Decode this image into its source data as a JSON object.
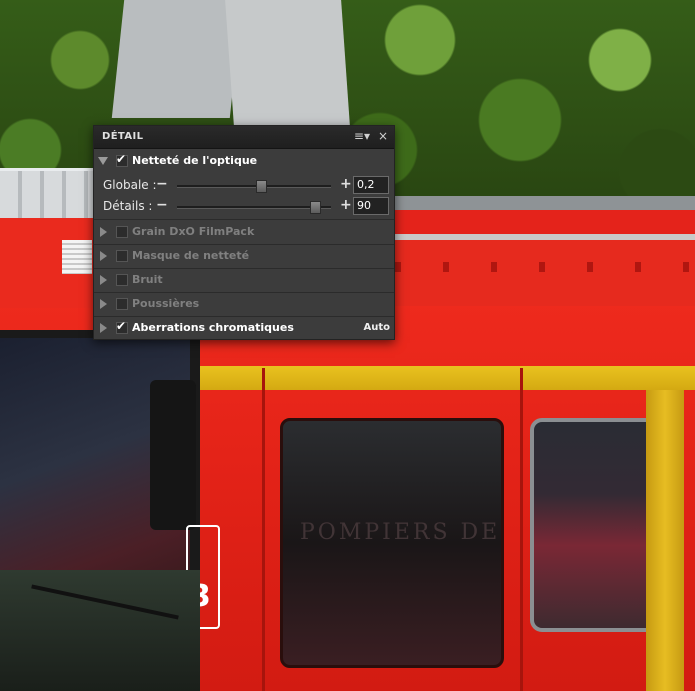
{
  "panel": {
    "title": "DÉTAIL",
    "menu_icon": "≡▾",
    "close_icon": "×"
  },
  "sections": [
    {
      "label": "Netteté de l'optique",
      "checked": true,
      "expanded": true,
      "enabled": true
    },
    {
      "label": "Grain DxO FilmPack",
      "checked": false,
      "expanded": false,
      "enabled": false
    },
    {
      "label": "Masque de netteté",
      "checked": false,
      "expanded": false,
      "enabled": false
    },
    {
      "label": "Bruit",
      "checked": false,
      "expanded": false,
      "enabled": false
    },
    {
      "label": "Poussières",
      "checked": false,
      "expanded": false,
      "enabled": false
    },
    {
      "label": "Aberrations chromatiques",
      "checked": true,
      "expanded": false,
      "enabled": true,
      "badge": "Auto"
    }
  ],
  "sliders": [
    {
      "label": "Globale :",
      "value": "0,2",
      "level": 0.55
    },
    {
      "label": "Détails :",
      "value": "90",
      "level": 0.9
    }
  ],
  "photo": {
    "door_lettering": "POMPIERS DE",
    "cab_number": "3"
  }
}
